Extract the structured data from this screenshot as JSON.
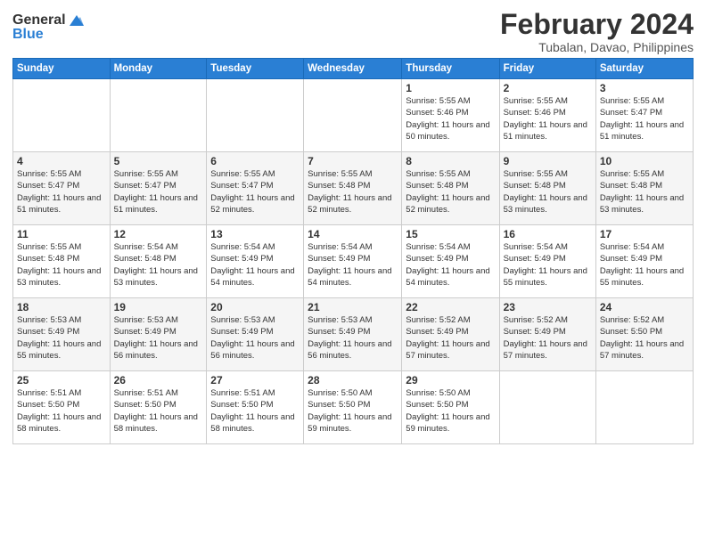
{
  "header": {
    "logo_general": "General",
    "logo_blue": "Blue",
    "month_title": "February 2024",
    "location": "Tubalan, Davao, Philippines"
  },
  "days_of_week": [
    "Sunday",
    "Monday",
    "Tuesday",
    "Wednesday",
    "Thursday",
    "Friday",
    "Saturday"
  ],
  "weeks": [
    [
      {
        "day": "",
        "info": ""
      },
      {
        "day": "",
        "info": ""
      },
      {
        "day": "",
        "info": ""
      },
      {
        "day": "",
        "info": ""
      },
      {
        "day": "1",
        "info": "Sunrise: 5:55 AM\nSunset: 5:46 PM\nDaylight: 11 hours\nand 50 minutes."
      },
      {
        "day": "2",
        "info": "Sunrise: 5:55 AM\nSunset: 5:46 PM\nDaylight: 11 hours\nand 51 minutes."
      },
      {
        "day": "3",
        "info": "Sunrise: 5:55 AM\nSunset: 5:47 PM\nDaylight: 11 hours\nand 51 minutes."
      }
    ],
    [
      {
        "day": "4",
        "info": "Sunrise: 5:55 AM\nSunset: 5:47 PM\nDaylight: 11 hours\nand 51 minutes."
      },
      {
        "day": "5",
        "info": "Sunrise: 5:55 AM\nSunset: 5:47 PM\nDaylight: 11 hours\nand 51 minutes."
      },
      {
        "day": "6",
        "info": "Sunrise: 5:55 AM\nSunset: 5:47 PM\nDaylight: 11 hours\nand 52 minutes."
      },
      {
        "day": "7",
        "info": "Sunrise: 5:55 AM\nSunset: 5:48 PM\nDaylight: 11 hours\nand 52 minutes."
      },
      {
        "day": "8",
        "info": "Sunrise: 5:55 AM\nSunset: 5:48 PM\nDaylight: 11 hours\nand 52 minutes."
      },
      {
        "day": "9",
        "info": "Sunrise: 5:55 AM\nSunset: 5:48 PM\nDaylight: 11 hours\nand 53 minutes."
      },
      {
        "day": "10",
        "info": "Sunrise: 5:55 AM\nSunset: 5:48 PM\nDaylight: 11 hours\nand 53 minutes."
      }
    ],
    [
      {
        "day": "11",
        "info": "Sunrise: 5:55 AM\nSunset: 5:48 PM\nDaylight: 11 hours\nand 53 minutes."
      },
      {
        "day": "12",
        "info": "Sunrise: 5:54 AM\nSunset: 5:48 PM\nDaylight: 11 hours\nand 53 minutes."
      },
      {
        "day": "13",
        "info": "Sunrise: 5:54 AM\nSunset: 5:49 PM\nDaylight: 11 hours\nand 54 minutes."
      },
      {
        "day": "14",
        "info": "Sunrise: 5:54 AM\nSunset: 5:49 PM\nDaylight: 11 hours\nand 54 minutes."
      },
      {
        "day": "15",
        "info": "Sunrise: 5:54 AM\nSunset: 5:49 PM\nDaylight: 11 hours\nand 54 minutes."
      },
      {
        "day": "16",
        "info": "Sunrise: 5:54 AM\nSunset: 5:49 PM\nDaylight: 11 hours\nand 55 minutes."
      },
      {
        "day": "17",
        "info": "Sunrise: 5:54 AM\nSunset: 5:49 PM\nDaylight: 11 hours\nand 55 minutes."
      }
    ],
    [
      {
        "day": "18",
        "info": "Sunrise: 5:53 AM\nSunset: 5:49 PM\nDaylight: 11 hours\nand 55 minutes."
      },
      {
        "day": "19",
        "info": "Sunrise: 5:53 AM\nSunset: 5:49 PM\nDaylight: 11 hours\nand 56 minutes."
      },
      {
        "day": "20",
        "info": "Sunrise: 5:53 AM\nSunset: 5:49 PM\nDaylight: 11 hours\nand 56 minutes."
      },
      {
        "day": "21",
        "info": "Sunrise: 5:53 AM\nSunset: 5:49 PM\nDaylight: 11 hours\nand 56 minutes."
      },
      {
        "day": "22",
        "info": "Sunrise: 5:52 AM\nSunset: 5:49 PM\nDaylight: 11 hours\nand 57 minutes."
      },
      {
        "day": "23",
        "info": "Sunrise: 5:52 AM\nSunset: 5:49 PM\nDaylight: 11 hours\nand 57 minutes."
      },
      {
        "day": "24",
        "info": "Sunrise: 5:52 AM\nSunset: 5:50 PM\nDaylight: 11 hours\nand 57 minutes."
      }
    ],
    [
      {
        "day": "25",
        "info": "Sunrise: 5:51 AM\nSunset: 5:50 PM\nDaylight: 11 hours\nand 58 minutes."
      },
      {
        "day": "26",
        "info": "Sunrise: 5:51 AM\nSunset: 5:50 PM\nDaylight: 11 hours\nand 58 minutes."
      },
      {
        "day": "27",
        "info": "Sunrise: 5:51 AM\nSunset: 5:50 PM\nDaylight: 11 hours\nand 58 minutes."
      },
      {
        "day": "28",
        "info": "Sunrise: 5:50 AM\nSunset: 5:50 PM\nDaylight: 11 hours\nand 59 minutes."
      },
      {
        "day": "29",
        "info": "Sunrise: 5:50 AM\nSunset: 5:50 PM\nDaylight: 11 hours\nand 59 minutes."
      },
      {
        "day": "",
        "info": ""
      },
      {
        "day": "",
        "info": ""
      }
    ]
  ]
}
